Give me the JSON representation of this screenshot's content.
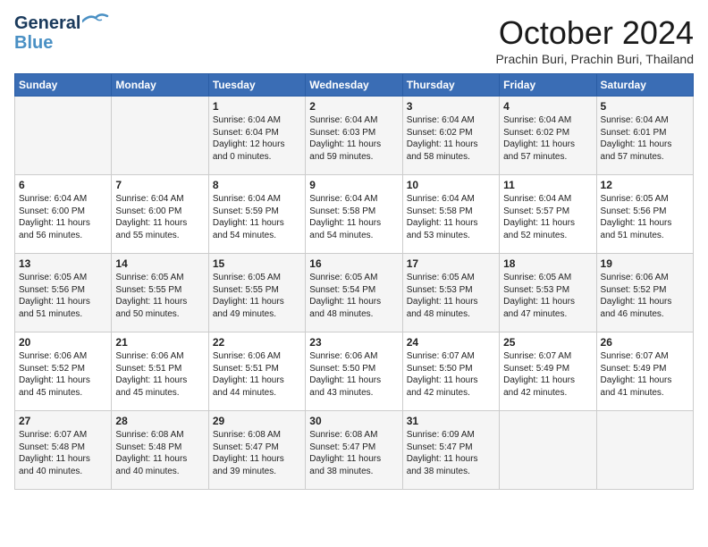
{
  "header": {
    "logo_line1": "General",
    "logo_line2": "Blue",
    "month": "October 2024",
    "location": "Prachin Buri, Prachin Buri, Thailand"
  },
  "weekdays": [
    "Sunday",
    "Monday",
    "Tuesday",
    "Wednesday",
    "Thursday",
    "Friday",
    "Saturday"
  ],
  "weeks": [
    [
      {
        "day": "",
        "content": ""
      },
      {
        "day": "",
        "content": ""
      },
      {
        "day": "1",
        "content": "Sunrise: 6:04 AM\nSunset: 6:04 PM\nDaylight: 12 hours\nand 0 minutes."
      },
      {
        "day": "2",
        "content": "Sunrise: 6:04 AM\nSunset: 6:03 PM\nDaylight: 11 hours\nand 59 minutes."
      },
      {
        "day": "3",
        "content": "Sunrise: 6:04 AM\nSunset: 6:02 PM\nDaylight: 11 hours\nand 58 minutes."
      },
      {
        "day": "4",
        "content": "Sunrise: 6:04 AM\nSunset: 6:02 PM\nDaylight: 11 hours\nand 57 minutes."
      },
      {
        "day": "5",
        "content": "Sunrise: 6:04 AM\nSunset: 6:01 PM\nDaylight: 11 hours\nand 57 minutes."
      }
    ],
    [
      {
        "day": "6",
        "content": "Sunrise: 6:04 AM\nSunset: 6:00 PM\nDaylight: 11 hours\nand 56 minutes."
      },
      {
        "day": "7",
        "content": "Sunrise: 6:04 AM\nSunset: 6:00 PM\nDaylight: 11 hours\nand 55 minutes."
      },
      {
        "day": "8",
        "content": "Sunrise: 6:04 AM\nSunset: 5:59 PM\nDaylight: 11 hours\nand 54 minutes."
      },
      {
        "day": "9",
        "content": "Sunrise: 6:04 AM\nSunset: 5:58 PM\nDaylight: 11 hours\nand 54 minutes."
      },
      {
        "day": "10",
        "content": "Sunrise: 6:04 AM\nSunset: 5:58 PM\nDaylight: 11 hours\nand 53 minutes."
      },
      {
        "day": "11",
        "content": "Sunrise: 6:04 AM\nSunset: 5:57 PM\nDaylight: 11 hours\nand 52 minutes."
      },
      {
        "day": "12",
        "content": "Sunrise: 6:05 AM\nSunset: 5:56 PM\nDaylight: 11 hours\nand 51 minutes."
      }
    ],
    [
      {
        "day": "13",
        "content": "Sunrise: 6:05 AM\nSunset: 5:56 PM\nDaylight: 11 hours\nand 51 minutes."
      },
      {
        "day": "14",
        "content": "Sunrise: 6:05 AM\nSunset: 5:55 PM\nDaylight: 11 hours\nand 50 minutes."
      },
      {
        "day": "15",
        "content": "Sunrise: 6:05 AM\nSunset: 5:55 PM\nDaylight: 11 hours\nand 49 minutes."
      },
      {
        "day": "16",
        "content": "Sunrise: 6:05 AM\nSunset: 5:54 PM\nDaylight: 11 hours\nand 48 minutes."
      },
      {
        "day": "17",
        "content": "Sunrise: 6:05 AM\nSunset: 5:53 PM\nDaylight: 11 hours\nand 48 minutes."
      },
      {
        "day": "18",
        "content": "Sunrise: 6:05 AM\nSunset: 5:53 PM\nDaylight: 11 hours\nand 47 minutes."
      },
      {
        "day": "19",
        "content": "Sunrise: 6:06 AM\nSunset: 5:52 PM\nDaylight: 11 hours\nand 46 minutes."
      }
    ],
    [
      {
        "day": "20",
        "content": "Sunrise: 6:06 AM\nSunset: 5:52 PM\nDaylight: 11 hours\nand 45 minutes."
      },
      {
        "day": "21",
        "content": "Sunrise: 6:06 AM\nSunset: 5:51 PM\nDaylight: 11 hours\nand 45 minutes."
      },
      {
        "day": "22",
        "content": "Sunrise: 6:06 AM\nSunset: 5:51 PM\nDaylight: 11 hours\nand 44 minutes."
      },
      {
        "day": "23",
        "content": "Sunrise: 6:06 AM\nSunset: 5:50 PM\nDaylight: 11 hours\nand 43 minutes."
      },
      {
        "day": "24",
        "content": "Sunrise: 6:07 AM\nSunset: 5:50 PM\nDaylight: 11 hours\nand 42 minutes."
      },
      {
        "day": "25",
        "content": "Sunrise: 6:07 AM\nSunset: 5:49 PM\nDaylight: 11 hours\nand 42 minutes."
      },
      {
        "day": "26",
        "content": "Sunrise: 6:07 AM\nSunset: 5:49 PM\nDaylight: 11 hours\nand 41 minutes."
      }
    ],
    [
      {
        "day": "27",
        "content": "Sunrise: 6:07 AM\nSunset: 5:48 PM\nDaylight: 11 hours\nand 40 minutes."
      },
      {
        "day": "28",
        "content": "Sunrise: 6:08 AM\nSunset: 5:48 PM\nDaylight: 11 hours\nand 40 minutes."
      },
      {
        "day": "29",
        "content": "Sunrise: 6:08 AM\nSunset: 5:47 PM\nDaylight: 11 hours\nand 39 minutes."
      },
      {
        "day": "30",
        "content": "Sunrise: 6:08 AM\nSunset: 5:47 PM\nDaylight: 11 hours\nand 38 minutes."
      },
      {
        "day": "31",
        "content": "Sunrise: 6:09 AM\nSunset: 5:47 PM\nDaylight: 11 hours\nand 38 minutes."
      },
      {
        "day": "",
        "content": ""
      },
      {
        "day": "",
        "content": ""
      }
    ]
  ]
}
